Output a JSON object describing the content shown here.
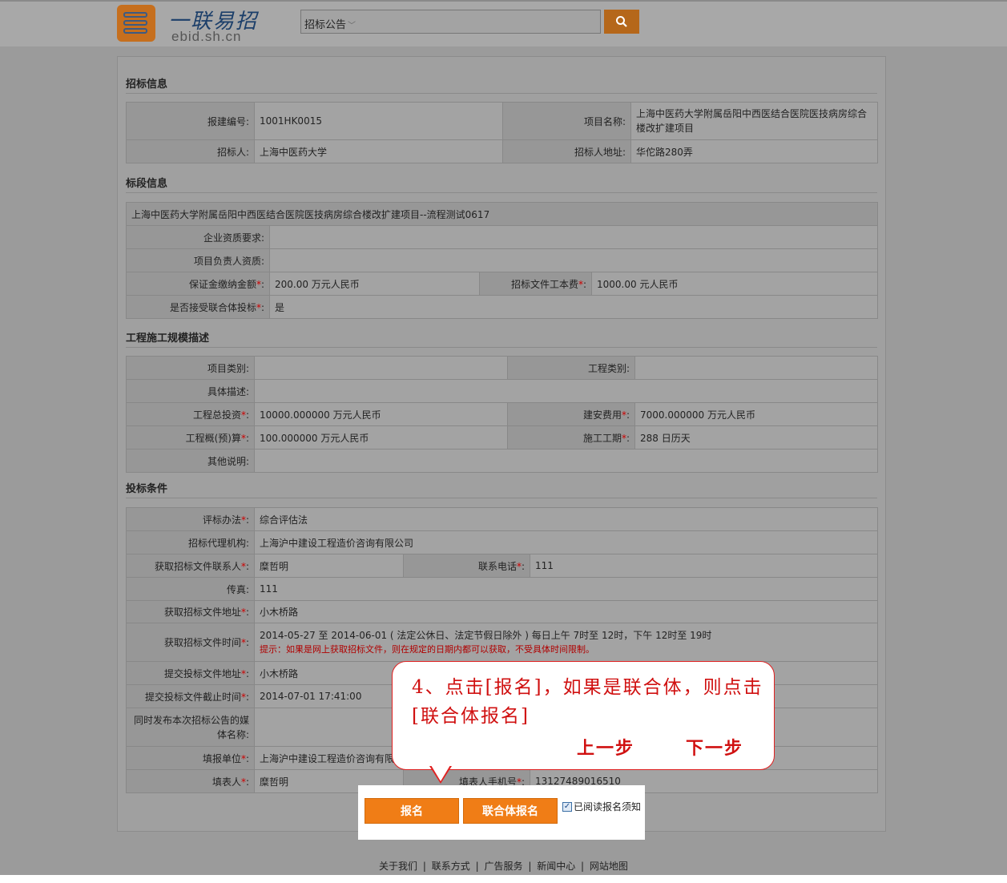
{
  "header": {
    "logo_cn": "一联易招",
    "logo_en": "ebid.sh.cn",
    "search_category": "招标公告",
    "search_icon": "magnifier-icon"
  },
  "sections": {
    "bid_info": "招标信息",
    "lot_info": "标段信息",
    "scale": "工程施工规模描述",
    "conditions": "投标条件"
  },
  "bid_info": {
    "reg_no_label": "报建编号:",
    "reg_no": "1001HK0015",
    "project_name_label": "项目名称:",
    "project_name": "上海中医药大学附属岳阳中西医结合医院医技病房综合楼改扩建项目",
    "tenderer_label": "招标人:",
    "tenderer": "上海中医药大学",
    "tenderer_addr_label": "招标人地址:",
    "tenderer_addr": "华佗路280弄"
  },
  "lot_info": {
    "lot_title": "上海中医药大学附属岳阳中西医结合医院医技病房综合楼改扩建项目--流程测试0617",
    "qual_label": "企业资质要求:",
    "qual": "",
    "pm_label": "项目负责人资质:",
    "pm": "",
    "deposit_label": "保证金缴纳金额",
    "deposit": "200.00 万元人民币",
    "doc_fee_label": "招标文件工本费",
    "doc_fee": "1000.00 元人民币",
    "consortium_label": "是否接受联合体投标",
    "consortium": "是"
  },
  "scale": {
    "category_label": "项目类别:",
    "category": "",
    "eng_type_label": "工程类别:",
    "eng_type": "",
    "desc_label": "具体描述:",
    "desc": "",
    "total_inv_label": "工程总投资",
    "total_inv": "10000.000000 万元人民币",
    "build_cost_label": "建安费用",
    "build_cost": "7000.000000 万元人民币",
    "budget_label": "工程概(预)算",
    "budget": "100.000000 万元人民币",
    "period_label": "施工工期",
    "period": "288 日历天",
    "other_label": "其他说明:",
    "other": ""
  },
  "conditions": {
    "eval_label": "评标办法",
    "eval": "综合评估法",
    "agency_label": "招标代理机构:",
    "agency": "上海沪中建设工程造价咨询有限公司",
    "contact_label": "获取招标文件联系人",
    "contact": "糜哲明",
    "phone_label": "联系电话",
    "phone": "111",
    "fax_label": "传真:",
    "fax": "111",
    "get_addr_label": "获取招标文件地址",
    "get_addr": "小木桥路",
    "get_time_label": "获取招标文件时间",
    "get_time": "2014-05-27 至 2014-06-01 ( 法定公休日、法定节假日除外 ) 每日上午 7时至 12时，下午 12时至 19时",
    "get_time_hint": "提示：如果是网上获取招标文件，则在规定的日期内都可以获取，不受具体时间限制。",
    "submit_addr_label": "提交投标文件地址",
    "submit_addr": "小木桥路",
    "deadline_label": "提交投标文件截止时间",
    "deadline": "2014-07-01 17:41:00",
    "media_label": "同时发布本次招标公告的媒体名称:",
    "media": "",
    "filler_unit_label": "填报单位",
    "filler_unit": "上海沪中建设工程造价咨询有限公司",
    "filler_label": "填表人",
    "filler": "糜哲明",
    "filler_phone_label": "填表人手机号",
    "filler_phone": "13127489016510"
  },
  "req_mark": "*",
  "colon": ":",
  "actions": {
    "register": "报名",
    "consortium_register": "联合体报名",
    "read_notice": "已阅读报名须知",
    "read_checked": true
  },
  "callout": {
    "text": "4、点击[报名]，如果是联合体，则点击[联合体报名]",
    "prev": "上一步",
    "next": "下一步"
  },
  "footer": {
    "links": [
      "关于我们",
      "联系方式",
      "广告服务",
      "新闻中心",
      "网站地图"
    ],
    "separator": "|"
  },
  "colors": {
    "overlay_gray": "#9b9b9b",
    "button_orange": "#f07d16",
    "callout_red": "#d01010",
    "logo_orange": "#c66f1e"
  }
}
